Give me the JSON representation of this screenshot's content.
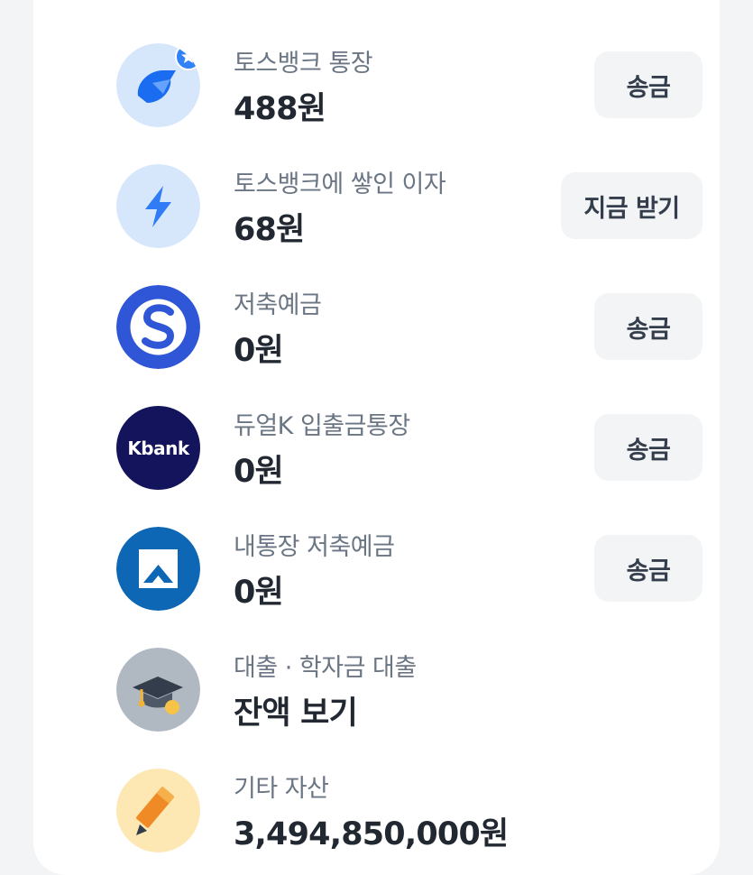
{
  "accounts": [
    {
      "label": "토스뱅크 통장",
      "value": "488원",
      "button": "송금",
      "icon": "toss-bank-icon"
    },
    {
      "label": "토스뱅크에 쌓인 이자",
      "value": "68원",
      "button": "지금 받기",
      "icon": "lightning-icon"
    },
    {
      "label": "저축예금",
      "value": "0원",
      "button": "송금",
      "icon": "shinhan-bank-icon"
    },
    {
      "label": "듀얼K 입출금통장",
      "value": "0원",
      "button": "송금",
      "icon": "kbank-icon",
      "icon_text": "Kbank"
    },
    {
      "label": "내통장 저축예금",
      "value": "0원",
      "button": "송금",
      "icon": "woori-bank-icon"
    },
    {
      "label": "대출 · 학자금 대출",
      "value": "잔액 보기",
      "icon": "graduation-cap-icon"
    },
    {
      "label": "기타 자산",
      "value": "3,494,850,000원",
      "icon": "pencil-icon"
    }
  ],
  "colors": {
    "background": "#f2f4f6",
    "card": "#ffffff",
    "toss_blue": "#3182f6",
    "kbank": "#13145c",
    "shinhan": "#2f56d7",
    "woori": "#0d67b5"
  }
}
